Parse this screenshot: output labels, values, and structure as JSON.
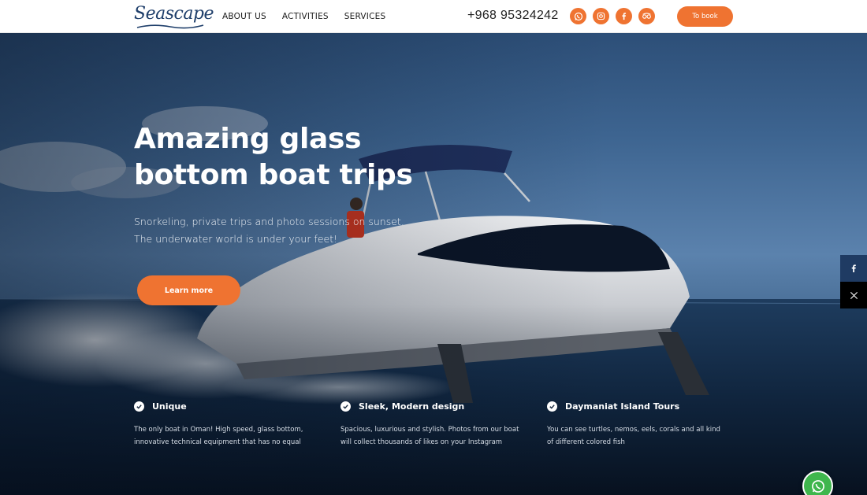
{
  "header": {
    "logo_text": "Seascape",
    "nav": [
      {
        "label": "ABOUT US"
      },
      {
        "label": "ACTIVITIES"
      },
      {
        "label": "SERVICES"
      }
    ],
    "phone": "+968 95324242",
    "socials": [
      {
        "icon": "whatsapp-icon"
      },
      {
        "icon": "instagram-icon"
      },
      {
        "icon": "facebook-icon"
      },
      {
        "icon": "tripadvisor-icon"
      }
    ],
    "book_label": "To book"
  },
  "hero": {
    "title_line1": "Amazing glass",
    "title_line2": "bottom boat trips",
    "subtitle_line1": "Snorkeling, private trips and photo sessions on sunset.",
    "subtitle_line2": "The underwater world is under your feet!",
    "cta_label": "Learn more"
  },
  "features": [
    {
      "title": "Unique",
      "description": "The only boat in Oman! High speed, glass bottom, innovative technical equipment that has no equal"
    },
    {
      "title": "Sleek, Modern design",
      "description": "Spacious, luxurious and stylish. Photos from our boat will collect thousands of likes on your Instagram"
    },
    {
      "title": "Daymaniat Island Tours",
      "description": "You can see turtles, nemos, eels, corals and all kind of different colored fish"
    }
  ],
  "share": [
    {
      "icon": "facebook-icon"
    },
    {
      "icon": "x-twitter-icon"
    }
  ],
  "colors": {
    "accent": "#ef7331",
    "whatsapp": "#3fb64d",
    "logo": "#1e3e6a"
  }
}
